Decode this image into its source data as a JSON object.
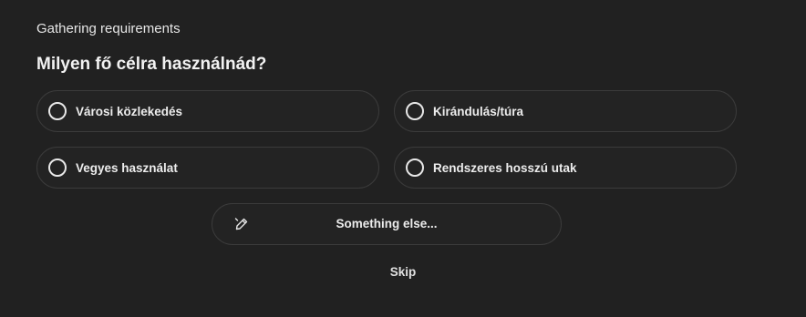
{
  "header": {
    "title": "Gathering requirements"
  },
  "question": "Milyen fő célra használnád?",
  "options": [
    {
      "label": "Városi közlekedés",
      "selected": false
    },
    {
      "label": "Kirándulás/túra",
      "selected": false
    },
    {
      "label": "Vegyes használat",
      "selected": false
    },
    {
      "label": "Rendszeres hosszú utak",
      "selected": false
    }
  ],
  "other": {
    "label": "Something else...",
    "icon": "pencil-icon"
  },
  "skip": {
    "label": "Skip"
  }
}
